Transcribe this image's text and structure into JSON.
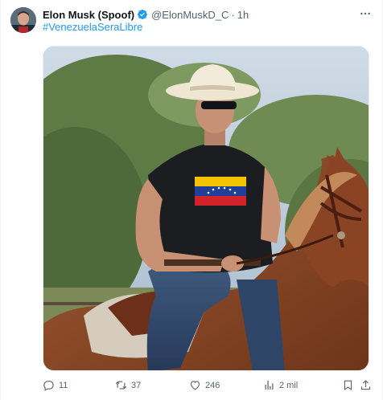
{
  "tweet": {
    "author_name": "Elon Musk (Spoof)",
    "handle": "@ElonMuskD_C",
    "separator": "·",
    "time": "1h",
    "hashtag": "#VenezuelaSeraLibre"
  },
  "actions": {
    "reply_count": "11",
    "retweet_count": "37",
    "like_count": "246",
    "views_count": "2 mil"
  },
  "colors": {
    "accent": "#1d9bf0",
    "secondary_text": "#536471",
    "primary_text": "#0f1419"
  },
  "icons": {
    "verified": "verified-badge-icon",
    "more": "more-horizontal-icon",
    "reply": "reply-icon",
    "retweet": "retweet-icon",
    "like": "heart-icon",
    "views": "analytics-icon",
    "bookmark": "bookmark-icon",
    "share": "share-icon"
  }
}
